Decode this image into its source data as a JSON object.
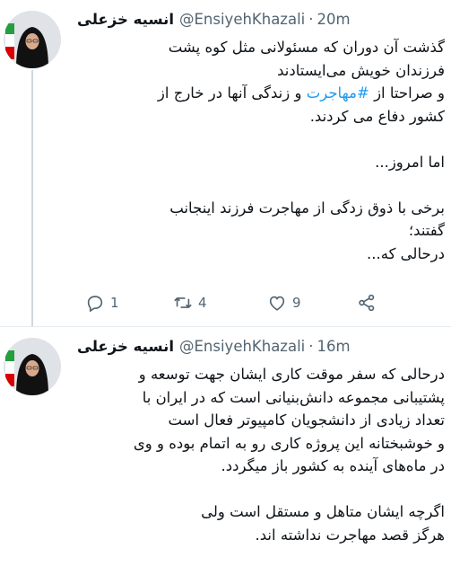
{
  "tweets": [
    {
      "name": "انسیه خزعلی",
      "handle": "@EnsiyehKhazali",
      "separator": "·",
      "time": "20m",
      "lines": [
        {
          "text": "گذشت آن دوران که مسئولانی مثل کوه پشت"
        },
        {
          "text": "فرزندان خویش می‌ایستادند"
        },
        {
          "pre": "و صراحتا از ",
          "hashtag": "#مهاجرت",
          "post": " و زندگی آنها در خارج از"
        },
        {
          "text": "کشور دفاع می کردند."
        },
        {
          "text": ""
        },
        {
          "text": "اما امروز..."
        },
        {
          "text": ""
        },
        {
          "text": "برخی با ذوق زدگی از مهاجرت فرزند اینجانب"
        },
        {
          "text": "گفتند؛"
        },
        {
          "text": "درحالی که..."
        }
      ],
      "actions": {
        "replies": "1",
        "retweets": "4",
        "likes": "9"
      }
    },
    {
      "name": "انسیه خزعلی",
      "handle": "@EnsiyehKhazali",
      "separator": "·",
      "time": "16m",
      "lines": [
        {
          "text": "درحالی که سفر موقت کاری ایشان جهت توسعه و"
        },
        {
          "text": "پشتیبانی مجموعه دانش‌بنیانی است که در ایران با"
        },
        {
          "text": "تعداد زیادی از دانشجویان کامپیوتر فعال است"
        },
        {
          "text": "و خوشبختانه این پروژه کاری رو به اتمام بوده و وی"
        },
        {
          "text": "در ماه‌های آینده به کشور باز میگردد."
        },
        {
          "text": ""
        },
        {
          "text": "اگرچه ایشان متاهل و مستقل است ولی"
        },
        {
          "text": "هرگز قصد مهاجرت نداشته اند."
        }
      ]
    }
  ],
  "icons": {
    "reply": "reply-icon",
    "retweet": "retweet-icon",
    "like": "heart-icon",
    "share": "share-icon"
  }
}
